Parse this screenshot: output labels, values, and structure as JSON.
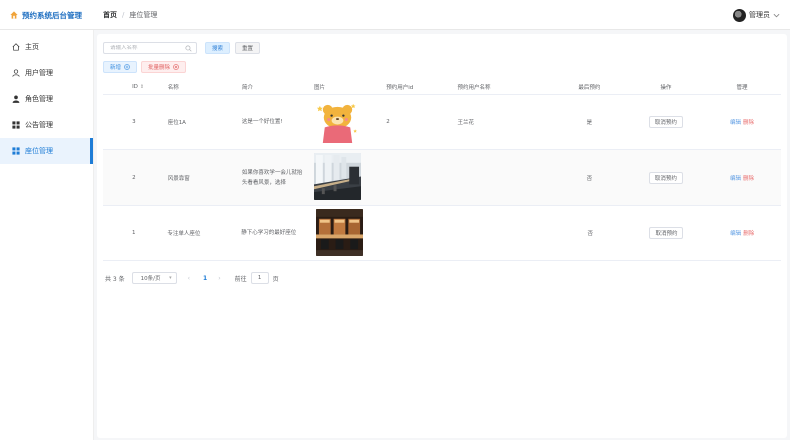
{
  "app": {
    "title": "预约系统后台管理"
  },
  "breadcrumb": {
    "home": "首页",
    "sep": "/",
    "current": "座位管理"
  },
  "user": {
    "name": "管理员"
  },
  "sidebar": {
    "items": [
      {
        "label": "主页",
        "icon": "home-icon"
      },
      {
        "label": "用户管理",
        "icon": "user-icon"
      },
      {
        "label": "角色管理",
        "icon": "role-icon"
      },
      {
        "label": "公告管理",
        "icon": "grid-icon"
      },
      {
        "label": "座位管理",
        "icon": "grid-icon",
        "active": true
      }
    ]
  },
  "toolbar": {
    "search_placeholder": "请输入名称",
    "search_label": "搜索",
    "reset_label": "重置",
    "add_label": "新增",
    "batch_delete_label": "批量删除"
  },
  "table": {
    "headers": {
      "id": "ID",
      "name": "名称",
      "intro": "简介",
      "image": "图片",
      "user_id": "预约用户id",
      "user_name": "预约用户名称",
      "last": "最后预约",
      "op": "操作",
      "mgr": "管理"
    },
    "rows": [
      {
        "id": "3",
        "name": "座位1A",
        "intro": "这是一个好位置!",
        "image": "bear-cartoon",
        "user_id": "2",
        "user_name": "王兰花",
        "last": "是",
        "op": "取消预约",
        "edit": "编辑",
        "del": "删除"
      },
      {
        "id": "2",
        "name": "风景靠窗",
        "intro": "如果你喜欢学一会儿就抬头看看风景，选择",
        "image": "library-window",
        "user_id": "",
        "user_name": "",
        "last": "否",
        "op": "取消预约",
        "edit": "编辑",
        "del": "删除"
      },
      {
        "id": "1",
        "name": "专注单人座位",
        "intro": "静下心学习的最好座位",
        "image": "study-booth",
        "user_id": "",
        "user_name": "",
        "last": "否",
        "op": "取消预约",
        "edit": "编辑",
        "del": "删除"
      }
    ]
  },
  "pagination": {
    "total": "共 3 条",
    "page_size": "10条/页",
    "prev": "‹",
    "current_page": "1",
    "next": "›",
    "goto_label": "前往",
    "goto_value": "1",
    "page_unit": "页"
  }
}
